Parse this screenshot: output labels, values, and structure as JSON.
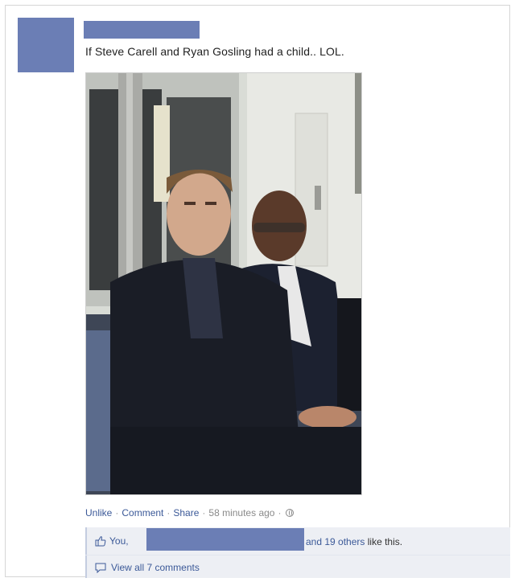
{
  "post": {
    "status_text": "If Steve Carell and Ryan Gosling had a child.. LOL.",
    "photo_alt": "Two men sitting on a subway train"
  },
  "actions": {
    "unlike": "Unlike",
    "comment": "Comment",
    "share": "Share",
    "timestamp": "58 minutes ago",
    "separator": "·"
  },
  "likes": {
    "you": "You,",
    "suffix_link": "and 19 others",
    "suffix_text": "like this."
  },
  "comments": {
    "view_all": "View all 7 comments"
  },
  "colors": {
    "brand": "#3b5998",
    "redaction": "#6b7eb5",
    "ufi_background": "#edeff4"
  },
  "icons": {
    "globe": "globe-icon",
    "thumbs_up": "thumbs-up-icon",
    "comment_bubble": "comment-bubble-icon"
  }
}
